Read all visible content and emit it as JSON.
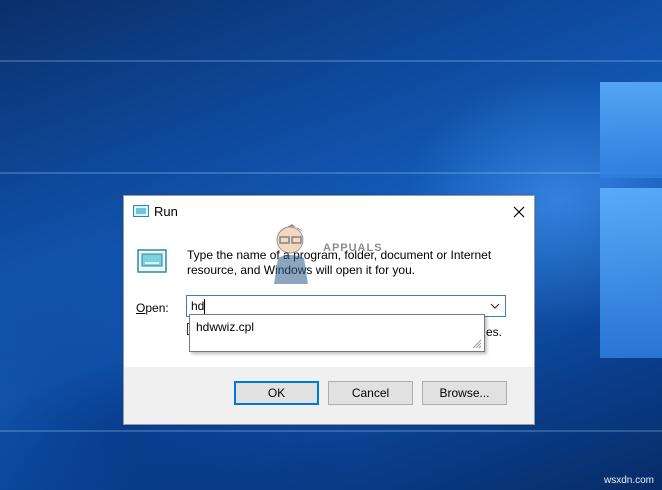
{
  "dialog": {
    "title": "Run",
    "description": "Type the name of a program, folder, document or Internet resource, and Windows will open it for you.",
    "open_label_underlined": "O",
    "open_label_rest": "pen:",
    "input_value": "hd",
    "autocomplete_item": "hdwwiz.cpl",
    "hidden_text_tail": "es.",
    "buttons": {
      "ok": "OK",
      "cancel": "Cancel",
      "browse": "Browse..."
    }
  },
  "watermark": {
    "text": "APPUALS"
  },
  "footer": {
    "credit": "wsxdn.com"
  },
  "colors": {
    "accent": "#0078d7",
    "desktop": "#0f4fa6",
    "dialog_bg": "#f0f0f0"
  }
}
